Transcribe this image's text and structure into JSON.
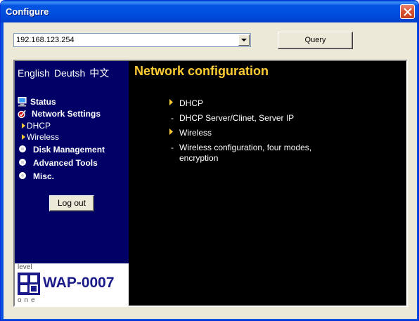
{
  "window": {
    "title": "Configure"
  },
  "toolbar": {
    "device_address": "192.168.123.254",
    "query_label": "Query"
  },
  "languages": [
    "English",
    "Deutsh",
    "中文"
  ],
  "nav": {
    "status": "Status",
    "network_settings": "Network Settings",
    "dhcp": "DHCP",
    "wireless": "Wireless",
    "disk_management": "Disk Management",
    "advanced_tools": "Advanced Tools",
    "misc": "Misc.",
    "logout": "Log out"
  },
  "logo": {
    "level": "level",
    "one": "one",
    "model": "WAP-0007"
  },
  "main": {
    "title": "Network configuration",
    "items": [
      {
        "label": "DHCP",
        "description": "DHCP Server/Clinet, Server IP"
      },
      {
        "label": "Wireless",
        "description": "Wireless configuration, four modes, encryption"
      }
    ],
    "dash": "-"
  },
  "colors": {
    "sidebar_bg": "#000066",
    "title_color": "#ffcc33",
    "content_bg": "#000000"
  },
  "icons": [
    "close-icon",
    "dropdown-arrow-icon",
    "computer-icon",
    "settings-check-icon",
    "triangle-bullet-icon",
    "radio-dot-icon"
  ]
}
